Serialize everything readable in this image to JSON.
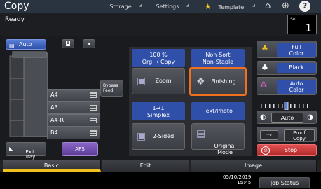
{
  "header": {
    "title": "Copy",
    "tabs": [
      {
        "label": "Storage"
      },
      {
        "label": "Settings"
      },
      {
        "label": "Template"
      }
    ]
  },
  "status": {
    "text": "Ready",
    "set_label": "Set",
    "set_value": "1"
  },
  "left": {
    "auto_label": "Auto",
    "trays": [
      "A4",
      "A3",
      "A4-R",
      "B4"
    ],
    "bypass_label": "Bypass\nFeed",
    "exit_tray_label": "Exit\nTray",
    "aps_label": "APS"
  },
  "center": {
    "zoom": {
      "top": "100 %\nOrg → Copy",
      "label": "Zoom"
    },
    "finishing": {
      "top": "Non-Sort\nNon-Staple",
      "label": "Finishing"
    },
    "duplex": {
      "top": "1→1\nSimplex",
      "label": "2-Sided"
    },
    "original": {
      "top": "Text/Photo",
      "label": "Original\nMode"
    }
  },
  "right": {
    "full_color": "Full\nColor",
    "black": "Black",
    "auto_color": "Auto\nColor",
    "density_auto": "Auto",
    "proof_copy": "Proof\nCopy",
    "stop": "Stop"
  },
  "bottom_tabs": [
    {
      "label": "Basic",
      "active": true
    },
    {
      "label": "Edit",
      "active": false
    },
    {
      "label": "Image",
      "active": false
    }
  ],
  "footer": {
    "date": "05/10/2019",
    "time": "15:45",
    "job_status": "Job Status"
  },
  "colors": {
    "highlight": "#f07020",
    "active_tab": "#f0c020",
    "blue": "#2f4fa8",
    "red": "#b02a2a"
  }
}
